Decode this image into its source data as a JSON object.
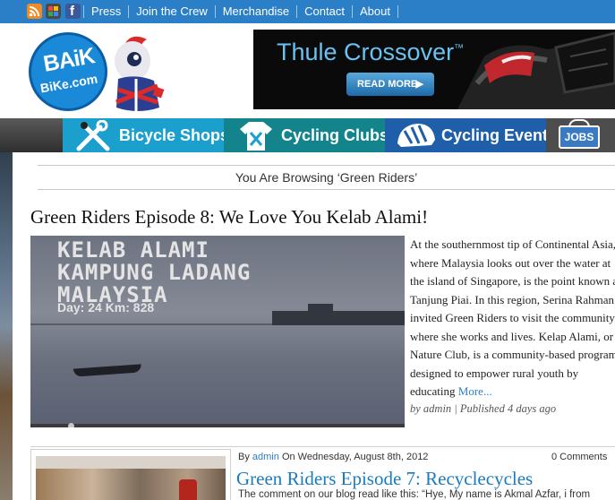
{
  "top_nav": {
    "links": [
      "Press",
      "Join the Crew",
      "Merchandise",
      "Contact",
      "About"
    ],
    "social_icons": [
      "rss-icon",
      "plus-icon",
      "facebook-icon"
    ]
  },
  "logo": {
    "main": "BAiK",
    "sub": "BiKe.com"
  },
  "banner": {
    "title": "Thule Crossover",
    "trademark": "™",
    "button": "READ MORE",
    "button_icon": "arrow-right-icon"
  },
  "categories": [
    {
      "label": "Bicycle Shops",
      "icon": "tools-icon",
      "color": "#1b9fcd"
    },
    {
      "label": "Cycling Clubs",
      "icon": "jersey-icon",
      "color": "#13848c"
    },
    {
      "label": "Cycling Events",
      "icon": "helmet-icon",
      "color": "#1f5fa9"
    },
    {
      "label": "JOBS",
      "icon": "sign-icon",
      "color": "#4d4d4d"
    }
  ],
  "browsing": {
    "text": "You Are Browsing ‘Green Riders’"
  },
  "post1": {
    "title": "Green Riders Episode 8: We Love You Kelab Alami!",
    "video_lines": [
      "KELAB ALAMI",
      "KAMPUNG LADANG",
      "MALAYSIA"
    ],
    "video_caption": "Day: 24  Km: 828",
    "excerpt": "At the southernmost tip of Continental Asia, where Malaysia looks out over the water at the island of Singapore, is the point known as Tanjung Piai. In this region, Serina Rahman invited Green Riders to visit the community where she works and lives. Kelap Alami, or Nature Club, is a community-based program designed to empower rural youth by educating",
    "more": "More...",
    "meta": "by admin | Published 4 days ago"
  },
  "post2": {
    "byline_prefix": "By",
    "author": "admin",
    "date": "On Wednesday, August 8th, 2012",
    "comments": "0 Comments",
    "title": "Green Riders Episode 7: Recyclecycles",
    "snippet": "The comment on our blog read like this: “Hye, My name is Akmal Azfar, i from"
  },
  "colors": {
    "topbar": "#2b7fc6",
    "link": "#2b7fc6",
    "title_link": "#1a7bc0"
  }
}
